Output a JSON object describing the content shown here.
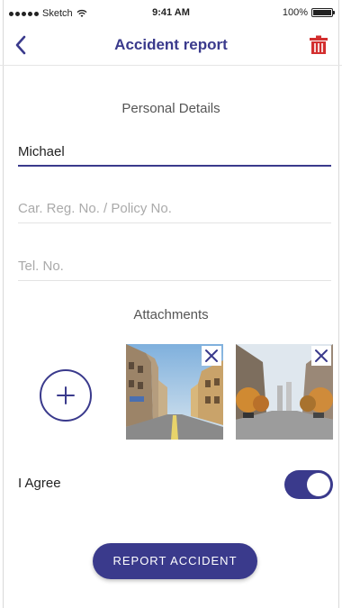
{
  "status_bar": {
    "carrier": "Sketch",
    "time": "9:41 AM",
    "battery": "100%",
    "battery_level": 1.0
  },
  "nav": {
    "title": "Accident report",
    "back_icon": "chevron-left-icon",
    "trash_icon": "trash-icon"
  },
  "personal_details": {
    "section_title": "Personal Details",
    "name_value": "Michael",
    "reg_placeholder": "Car. Reg. No. / Policy No.",
    "tel_placeholder": "Tel. No."
  },
  "attachments": {
    "section_title": "Attachments",
    "add_icon": "plus-icon",
    "remove_icon": "close-icon"
  },
  "agree": {
    "label": "I Agree",
    "checked": true
  },
  "submit": {
    "label": "REPORT ACCIDENT"
  },
  "colors": {
    "accent": "#3a3a8c",
    "danger": "#d32f2f",
    "placeholder": "#aaaaaa",
    "divider": "#e3e3e3"
  }
}
